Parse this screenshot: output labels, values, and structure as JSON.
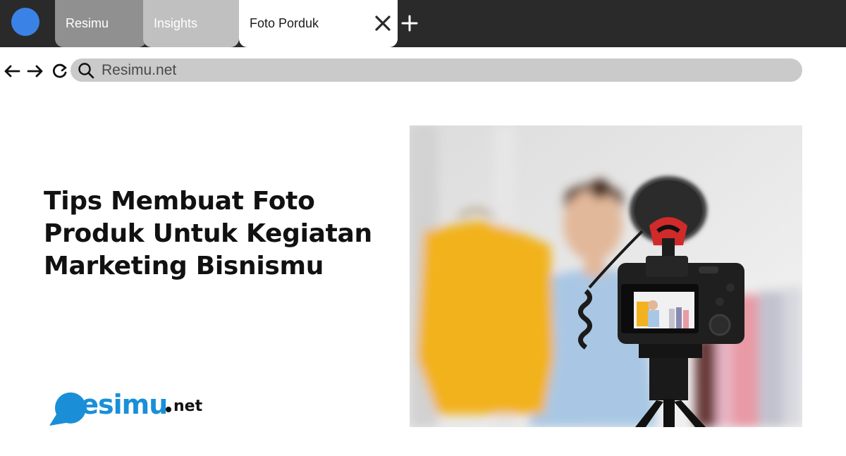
{
  "browser": {
    "tabs": [
      {
        "label": "Resimu"
      },
      {
        "label": "Insights"
      },
      {
        "label": "Foto Porduk"
      }
    ],
    "address_bar": {
      "url": "Resimu.net"
    },
    "icons": [
      "profile-avatar",
      "close-icon",
      "plus-icon",
      "arrow-left-icon",
      "arrow-right-icon",
      "reload-icon",
      "search-icon"
    ]
  },
  "page": {
    "headline": "Tips Membuat Foto Produk Untuk Kegiatan Marketing Bisnismu",
    "logo": {
      "name": "Resimu",
      "suffix": "net"
    }
  },
  "colors": {
    "accent": "#3b82e6",
    "logo_blue": "#1a8fd8",
    "tabbar": "#2a2a2a"
  }
}
